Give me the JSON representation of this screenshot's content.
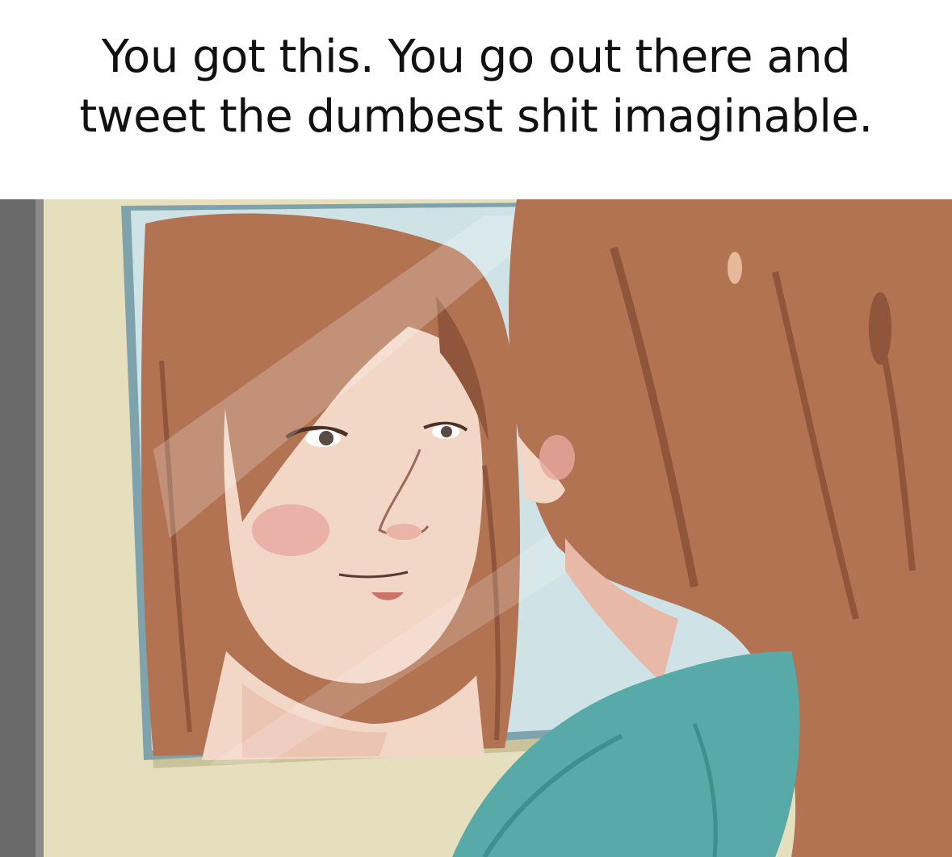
{
  "caption": {
    "line1": "You got this. You go out there and",
    "line2": "tweet the dumbest shit imaginable."
  },
  "illustration": {
    "icon": "mirror-reflection-illustration",
    "colors": {
      "wall": "#e6dfbd",
      "wall_shadow": "#c9c39c",
      "dark_edge": "#6a6a6a",
      "mirror_frame": "#7fa3ad",
      "mirror_bg": "#cfe3e7",
      "hair": "#b27352",
      "hair_dark": "#8f563b",
      "hair_light": "#c98c67",
      "skin": "#f2d6c6",
      "blush": "#e7a7a0",
      "lips": "#c9756a",
      "shirt": "#57aaa7",
      "shirt_dark": "#3f8f8c",
      "glare": "#ffffff"
    }
  }
}
